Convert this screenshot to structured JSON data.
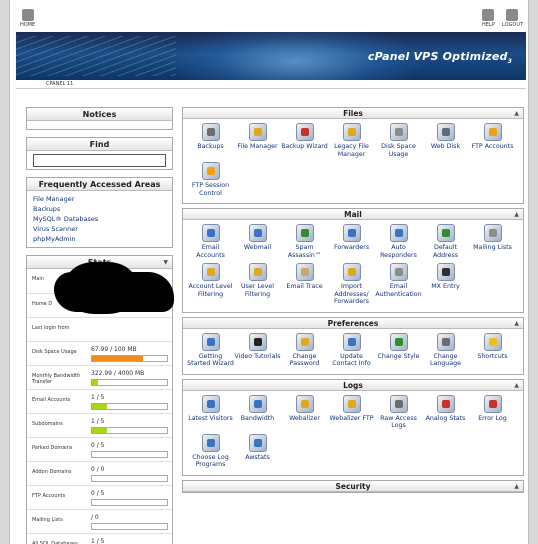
{
  "topbar": {
    "home": "HOME",
    "help": "HELP",
    "logout": "LOGOUT"
  },
  "banner": {
    "brand": "cPanel VPS Optimized",
    "version": "3"
  },
  "breadcrumb": "CPANEL 11",
  "left": {
    "notices": "Notices",
    "find": "Find",
    "faa": {
      "title": "Frequently Accessed Areas",
      "items": [
        "File Manager",
        "Backups",
        "MySQL® Databases",
        "Virus Scanner",
        "phpMyAdmin"
      ]
    },
    "stats": {
      "title": "Stats",
      "rows": [
        {
          "label": "Main",
          "value": "",
          "pct": null
        },
        {
          "label": "Home D",
          "value": "",
          "pct": null
        },
        {
          "label": "Last login from",
          "value": "",
          "pct": null
        },
        {
          "label": "Disk Space Usage",
          "value": "67.99 / 100 MB",
          "pct": 68,
          "color": "#f08c1e"
        },
        {
          "label": "Monthly Bandwidth Transfer",
          "value": "322.99 / 4000 MB",
          "pct": 8,
          "color": "#a6d81a"
        },
        {
          "label": "Email Accounts",
          "value": "1 / 5",
          "pct": 20,
          "color": "#a6d81a"
        },
        {
          "label": "Subdomains",
          "value": "1 / 5",
          "pct": 20,
          "color": "#a6d81a"
        },
        {
          "label": "Parked Domains",
          "value": "0 / 5",
          "pct": 0,
          "color": "#a6d81a"
        },
        {
          "label": "Addon Domains",
          "value": "0 / 0",
          "pct": 0,
          "color": "#a6d81a"
        },
        {
          "label": "FTP Accounts",
          "value": "0 / 5",
          "pct": 0,
          "color": "#a6d81a"
        },
        {
          "label": "Mailing Lists",
          "value": "/ 0",
          "pct": 0,
          "color": "#a6d81a"
        },
        {
          "label": "All SQL Databases",
          "value": "1 / 5",
          "pct": 20,
          "color": "#a6d81a"
        }
      ]
    }
  },
  "panels": [
    {
      "title": "Files",
      "items": [
        {
          "label": "Backups",
          "icon": "backups-icon",
          "color": "#6d6d6d"
        },
        {
          "label": "File Manager",
          "icon": "file-manager-icon",
          "color": "#e0a81a"
        },
        {
          "label": "Backup Wizard",
          "icon": "backup-wizard-icon",
          "color": "#c8322a"
        },
        {
          "label": "Legacy File Manager",
          "icon": "legacy-file-manager-icon",
          "color": "#e0a81a"
        },
        {
          "label": "Disk Space Usage",
          "icon": "disk-space-icon",
          "color": "#8c8c8c"
        },
        {
          "label": "Web Disk",
          "icon": "web-disk-icon",
          "color": "#5b6b80"
        },
        {
          "label": "FTP Accounts",
          "icon": "ftp-accounts-icon",
          "color": "#f0a010"
        },
        {
          "label": "FTP Session Control",
          "icon": "ftp-session-icon",
          "color": "#f0a010"
        }
      ]
    },
    {
      "title": "Mail",
      "items": [
        {
          "label": "Email Accounts",
          "icon": "email-accounts-icon",
          "color": "#3a73c6"
        },
        {
          "label": "Webmail",
          "icon": "webmail-icon",
          "color": "#3a73c6"
        },
        {
          "label": "Spam Assassin™",
          "icon": "spam-assassin-icon",
          "color": "#2f8f2f"
        },
        {
          "label": "Forwarders",
          "icon": "forwarders-icon",
          "color": "#3a73c6"
        },
        {
          "label": "Auto Responders",
          "icon": "auto-responders-icon",
          "color": "#3a73c6"
        },
        {
          "label": "Default Address",
          "icon": "default-address-icon",
          "color": "#2f8f2f"
        },
        {
          "label": "Mailing Lists",
          "icon": "mailing-lists-icon",
          "color": "#8c8c8c"
        },
        {
          "label": "Account Level Filtering",
          "icon": "account-filtering-icon",
          "color": "#e0a81a"
        },
        {
          "label": "User Level Filtering",
          "icon": "user-filtering-icon",
          "color": "#e0a81a"
        },
        {
          "label": "Email Trace",
          "icon": "email-trace-icon",
          "color": "#c9a86a"
        },
        {
          "label": "Import Addresses/ Forwarders",
          "icon": "import-addresses-icon",
          "color": "#e0a81a"
        },
        {
          "label": "Email Authentication",
          "icon": "email-auth-icon",
          "color": "#8c8c8c"
        },
        {
          "label": "MX Entry",
          "icon": "mx-entry-icon",
          "color": "#2f2f2f"
        }
      ]
    },
    {
      "title": "Preferences",
      "items": [
        {
          "label": "Getting Started Wizard",
          "icon": "getting-started-icon",
          "color": "#3a73c6"
        },
        {
          "label": "Video Tutorials",
          "icon": "video-tutorials-icon",
          "color": "#222222"
        },
        {
          "label": "Change Password",
          "icon": "change-password-icon",
          "color": "#e0a81a"
        },
        {
          "label": "Update Contact Info",
          "icon": "contact-info-icon",
          "color": "#3a73c6"
        },
        {
          "label": "Change Style",
          "icon": "change-style-icon",
          "color": "#2f8f2f"
        },
        {
          "label": "Change Language",
          "icon": "change-language-icon",
          "color": "#6d6d6d"
        },
        {
          "label": "Shortcuts",
          "icon": "shortcuts-icon",
          "color": "#f0c010"
        }
      ]
    },
    {
      "title": "Logs",
      "items": [
        {
          "label": "Latest Visitors",
          "icon": "latest-visitors-icon",
          "color": "#3a73c6"
        },
        {
          "label": "Bandwidth",
          "icon": "bandwidth-icon",
          "color": "#3a73c6"
        },
        {
          "label": "Webalizer",
          "icon": "webalizer-icon",
          "color": "#e0a81a"
        },
        {
          "label": "Webalizer FTP",
          "icon": "webalizer-ftp-icon",
          "color": "#e0a81a"
        },
        {
          "label": "Raw Access Logs",
          "icon": "raw-access-icon",
          "color": "#6d6d6d"
        },
        {
          "label": "Analog Stats",
          "icon": "analog-stats-icon",
          "color": "#c8322a"
        },
        {
          "label": "Error Log",
          "icon": "error-log-icon",
          "color": "#c8322a"
        },
        {
          "label": "Choose Log Programs",
          "icon": "log-programs-icon",
          "color": "#3a73c6"
        },
        {
          "label": "Awstats",
          "icon": "awstats-icon",
          "color": "#3a73c6"
        }
      ]
    },
    {
      "title": "Security",
      "items": []
    }
  ]
}
